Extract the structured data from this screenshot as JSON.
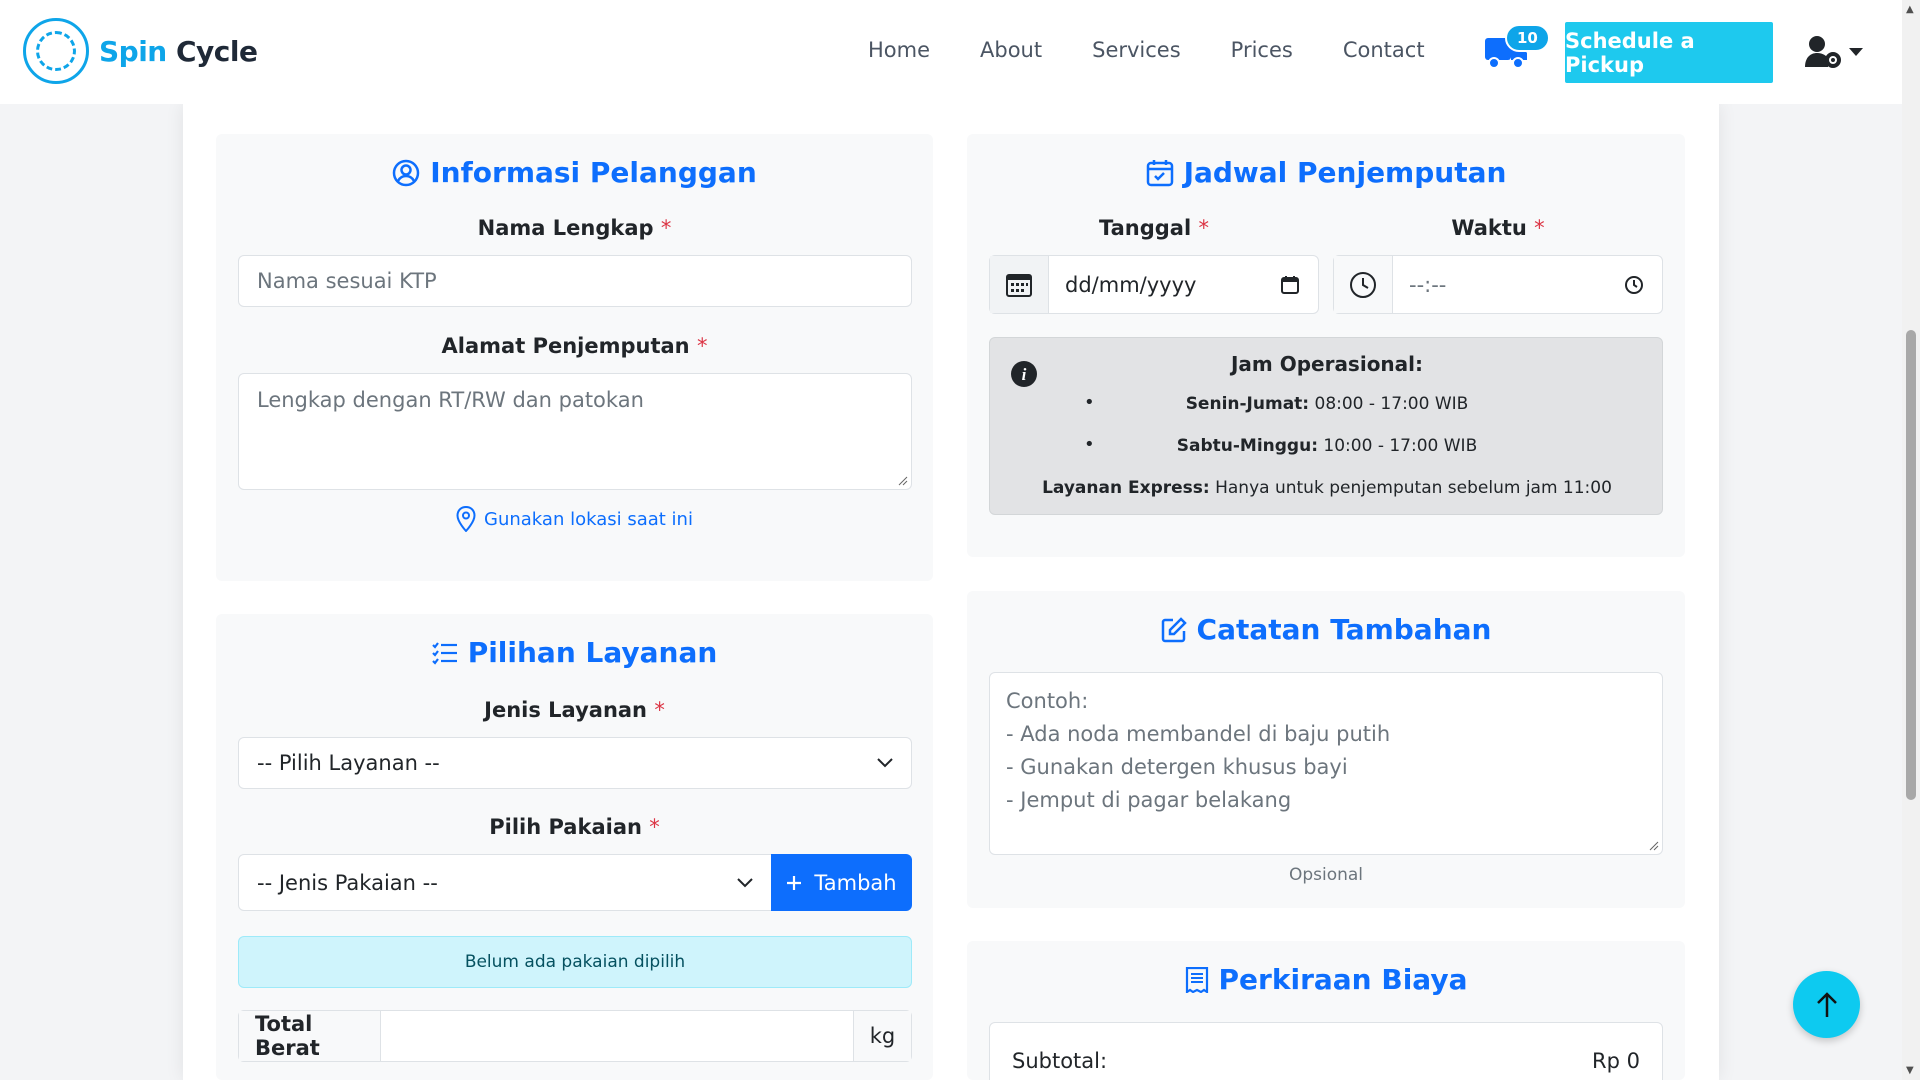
{
  "brand": {
    "spin": "Spin",
    "cycle": "Cycle"
  },
  "nav": {
    "home": "Home",
    "about": "About",
    "services": "Services",
    "prices": "Prices",
    "contact": "Contact"
  },
  "cart": {
    "count": "10"
  },
  "header": {
    "pickup_button": "Schedule a Pickup"
  },
  "customer": {
    "title": "Informasi Pelanggan",
    "name_label": "Nama Lengkap",
    "name_placeholder": "Nama sesuai KTP",
    "address_label": "Alamat Penjemputan",
    "address_placeholder": "Lengkap dengan RT/RW dan patokan",
    "location_link": "Gunakan lokasi saat ini",
    "required": "*"
  },
  "schedule": {
    "title": "Jadwal Penjemputan",
    "date_label": "Tanggal",
    "time_label": "Waktu",
    "date_value": "dd/mm/yyyy",
    "time_value": "--:--",
    "hours_title": "Jam Operasional:",
    "weekday_label": "Senin-Jumat:",
    "weekday_value": " 08:00 - 17:00 WIB",
    "weekend_label": "Sabtu-Minggu:",
    "weekend_value": " 10:00 - 17:00 WIB",
    "express_label": "Layanan Express:",
    "express_value": " Hanya untuk penjemputan sebelum jam 11:00"
  },
  "services": {
    "title": "Pilihan Layanan",
    "type_label": "Jenis Layanan",
    "type_selected": "-- Pilih Layanan --",
    "clothes_label": "Pilih Pakaian",
    "clothes_selected": "-- Jenis Pakaian --",
    "add_button": "Tambah",
    "empty_alert": "Belum ada pakaian dipilih",
    "total_weight_label": "Total Berat",
    "weight_unit": "kg"
  },
  "notes": {
    "title": "Catatan Tambahan",
    "placeholder_lines": [
      "Contoh:",
      "- Ada noda membandel di baju putih",
      "- Gunakan detergen khusus bayi",
      "- Jemput di pagar belakang"
    ],
    "helper": "Opsional"
  },
  "estimate": {
    "title": "Perkiraan Biaya",
    "subtotal_label": "Subtotal:",
    "subtotal_value": "Rp 0"
  },
  "colors": {
    "primary": "#0d6efd",
    "accent": "#0dcaf0",
    "brand": "#0ea5e9",
    "danger": "#dc3545"
  }
}
